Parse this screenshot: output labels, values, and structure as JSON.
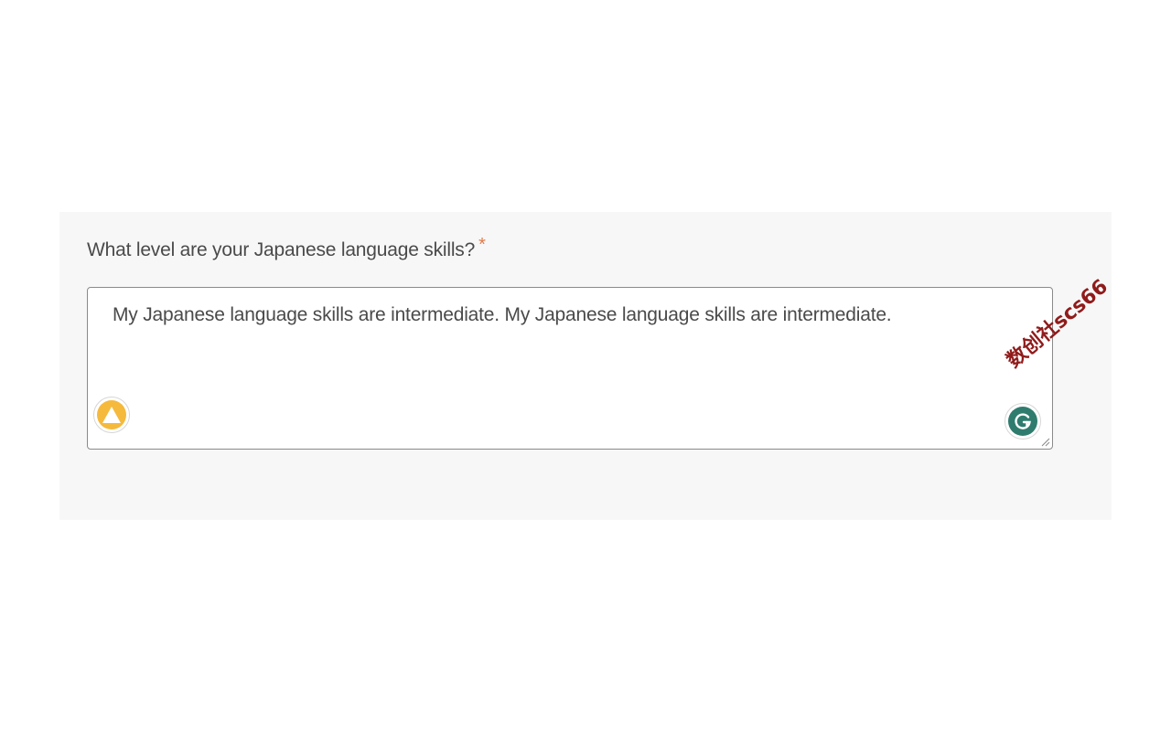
{
  "question": {
    "label": "What level are your Japanese language skills?",
    "required_marker": "*"
  },
  "answer": {
    "value": "My Japanese language skills are intermediate. My Japanese language skills are intermediate."
  },
  "extensions": {
    "left_icon": "triangle-logo-icon",
    "right_icon": "grammarly-icon"
  },
  "watermark": {
    "text": "数创社scs66"
  },
  "colors": {
    "card_background": "#f7f7f7",
    "required": "#e07b4a",
    "left_icon_bg": "#f5b93c",
    "right_icon_bg": "#2f7c6e",
    "watermark": "#8b1010"
  }
}
